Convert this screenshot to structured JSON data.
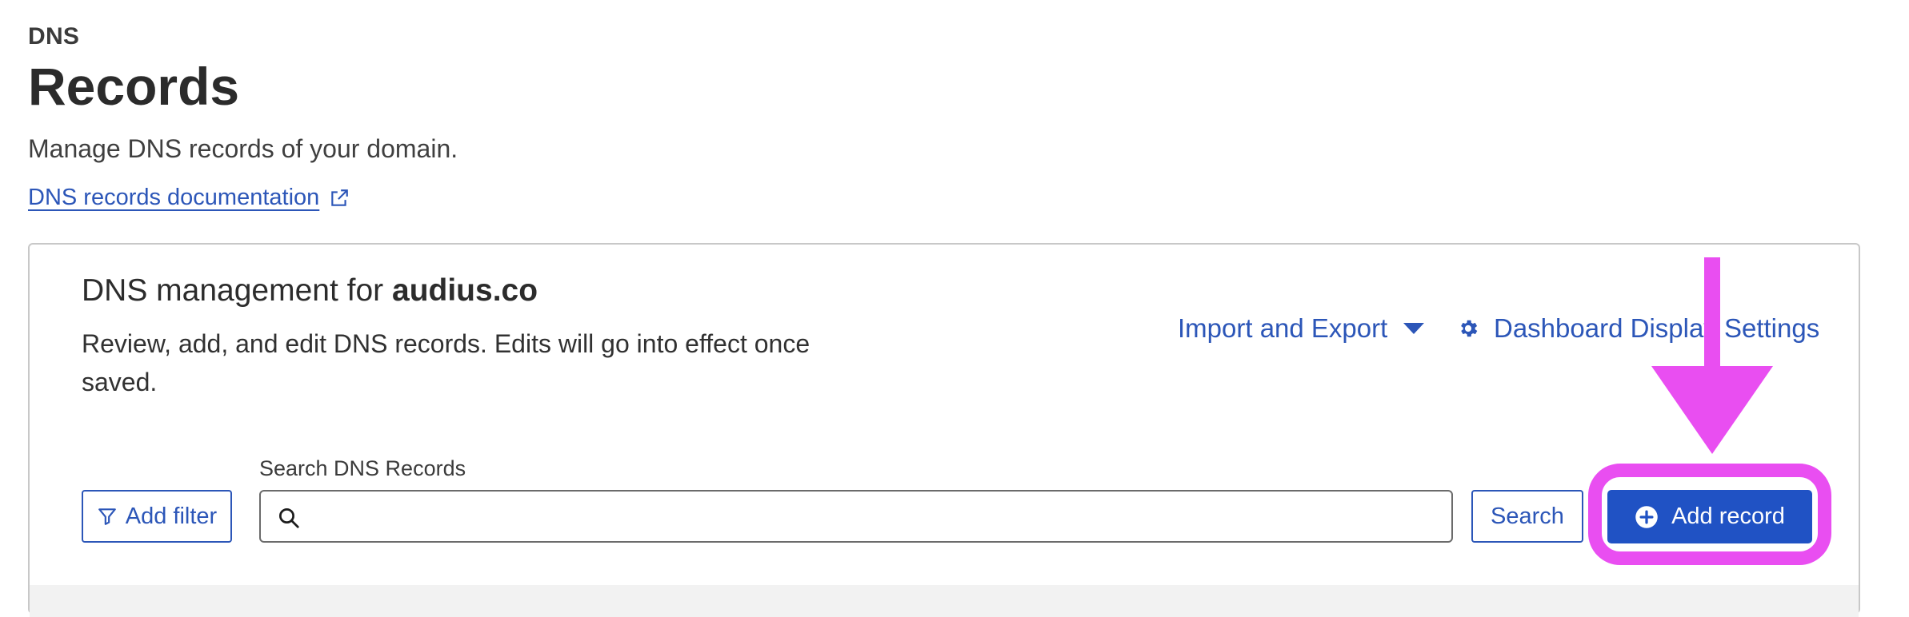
{
  "header": {
    "section": "DNS",
    "title": "Records",
    "description": "Manage DNS records of your domain.",
    "doc_link": "DNS records documentation"
  },
  "card": {
    "title_prefix": "DNS management for ",
    "domain": "audius.co",
    "description": "Review, add, and edit DNS records. Edits will go into effect once saved.",
    "import_export": "Import and Export",
    "display_settings": "Dashboard Display Settings"
  },
  "toolbar": {
    "add_filter": "Add filter",
    "search_label": "Search DNS Records",
    "search_value": "",
    "search_button": "Search",
    "add_record": "Add record"
  },
  "icons": {
    "external_link": "external-link-icon",
    "caret": "caret-down-icon",
    "gear": "gear-icon",
    "filter": "filter-icon",
    "search": "search-icon",
    "plus": "plus-circle-icon"
  },
  "colors": {
    "link": "#2c56b8",
    "primary_button": "#2052c4",
    "annotation": "#e94ef1"
  }
}
